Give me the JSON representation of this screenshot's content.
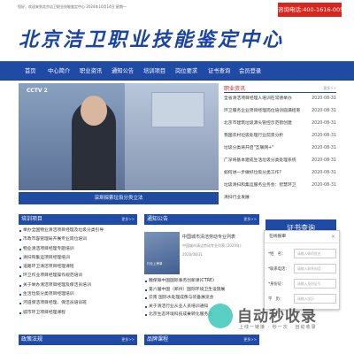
{
  "topbar": {
    "greeting": "您好，欢迎来到北京洁卫职业技能鉴定中心",
    "date": "2024年10月14日 星期一",
    "consult": "咨询电话:400-1616-005"
  },
  "header": {
    "logo_text": "北京洁卫职业技能鉴定中心"
  },
  "nav": {
    "items": [
      "首页",
      "中心简介",
      "职业资讯",
      "通知公告",
      "培训项目",
      "岗位要求",
      "证书查询",
      "会员登录"
    ]
  },
  "banner": {
    "channel": "CCTV 2",
    "pages": [
      "1",
      "2",
      "3",
      "4"
    ],
    "active_page": "3",
    "caption": "深圳探索垃圾分类立法"
  },
  "news": {
    "title": "职业资讯",
    "more": "更多>>",
    "items": [
      {
        "title": "全省清洁项目经理人培训在常德举办",
        "date": "2020-08-31"
      },
      {
        "title": "环卫服务企业项目经理岗位培训圆满结束",
        "date": "2020-08-31"
      },
      {
        "title": "北京市建筑垃圾源头管控示范街创建",
        "date": "2020-08-31"
      },
      {
        "title": "我国农村垃圾处理行业前景分析",
        "date": "2020-08-31"
      },
      {
        "title": "垃圾分类将开启\"互联网+\"",
        "date": "2020-08-31"
      },
      {
        "title": "广深将基本建成生活垃圾分类处理系统",
        "date": "2020-08-31"
      },
      {
        "title": "如何进一步做好垃圾分类工作?",
        "date": "2020-08-31"
      },
      {
        "title": "垃圾清扫和集运服务业务会：智慧环卫",
        "date": "2020-08-31"
      },
      {
        "title": "清扫行业发展",
        "date": ""
      }
    ]
  },
  "training": {
    "title": "培训项目",
    "more": "更多>>",
    "items": [
      "举办全国物业清洁项目经理及垃圾分类引导",
      "市政市容管理局开展专业岗位培训",
      "物业清洁项目经理专题培训",
      "清扫和集运项目经理培训",
      "道路环卫清洁项目经理课程",
      "环卫作业项目经理操作规范培训",
      "关于举办清洁项目经理及保洁员培训",
      "生活垃圾分类项目经理培训",
      "河道保洁项目经理、保洁员培训班",
      "城市环卫项目经理课程"
    ]
  },
  "notices": {
    "title": "通知公告",
    "more": "更多>>",
    "featured_title": "中国城市清洁劳动专业列表",
    "featured_sub": "中国城市清洁劳动专业列表 (2020年)",
    "featured_date": "2020/08/31",
    "thumb_text": "行业上榜单",
    "items": [
      "魏保障中国国际事务创新课(CTRE)",
      "第六届中国（郑州）国际环境卫生设施展",
      "云南 国际水处理成像与装备展览会",
      "关于清洁行业从业人员培训通知",
      "北京生态环境科技成果转化服务业"
    ]
  },
  "cert": {
    "label": "证书查询"
  },
  "login": {
    "title": "在线报审",
    "close": "×",
    "fields": [
      {
        "label": "*姓　名：",
        "placeholder": "请输入你的姓名"
      },
      {
        "label": "*联系电话：",
        "placeholder": "请输入联系电话"
      },
      {
        "label": "*身份证：",
        "placeholder": "请输入身份证号"
      },
      {
        "label": "学　历：",
        "placeholder": "请输入学历"
      }
    ]
  },
  "bottom": {
    "policy_title": "政策法规",
    "policy_more": "更多>>",
    "brand_title": "品牌课程",
    "brand_more": "更多>>"
  },
  "watermark": {
    "brand": "自动秒收录",
    "tag": "上线一链接 · 秒一次 · 自动收录"
  },
  "colors": {
    "primary": "#1f4ba5",
    "accent_red": "#d9251c",
    "logo_blue": "#1a43a6"
  }
}
